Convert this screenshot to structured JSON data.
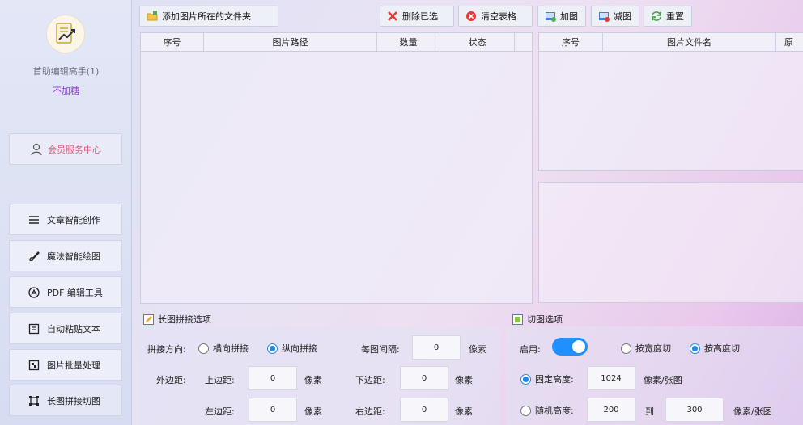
{
  "sidebar": {
    "user_name": "首助编辑高手(1)",
    "user_level": "不加糖",
    "member_label": "会员服务中心",
    "items": [
      {
        "label": "文章智能创作",
        "icon": "list-icon"
      },
      {
        "label": "魔法智能绘图",
        "icon": "brush-icon"
      },
      {
        "label": "PDF 编辑工具",
        "icon": "pdf-icon"
      },
      {
        "label": "自动粘贴文本",
        "icon": "paste-icon"
      },
      {
        "label": "图片批量处理",
        "icon": "image-icon"
      },
      {
        "label": "长图拼接切图",
        "icon": "crop-icon"
      }
    ]
  },
  "toolbar": {
    "add_folder": "添加图片所在的文件夹",
    "delete_selected": "删除已选",
    "clear_table": "清空表格",
    "add_image": "加图",
    "remove_image": "减图",
    "reset": "重置"
  },
  "left_table": {
    "columns": [
      "序号",
      "图片路径",
      "数量",
      "状态"
    ]
  },
  "right_table": {
    "columns": [
      "序号",
      "图片文件名",
      "原"
    ]
  },
  "stitch": {
    "title": "长图拼接选项",
    "direction_label": "拼接方向:",
    "horizontal": "横向拼接",
    "vertical": "纵向拼接",
    "direction_selected": "vertical",
    "gap_label": "每图间隔:",
    "gap_value": "0",
    "unit": "像素",
    "margin_label": "外边距:",
    "top_label": "上边距:",
    "top_value": "0",
    "bottom_label": "下边距:",
    "bottom_value": "0",
    "left_label": "左边距:",
    "left_value": "0",
    "right_label": "右边距:",
    "right_value": "0"
  },
  "cut": {
    "title": "切图选项",
    "enable_label": "启用:",
    "enabled": true,
    "by_width": "按宽度切",
    "by_height": "按高度切",
    "mode_selected": "height",
    "fixed_label": "固定高度:",
    "fixed_value": "1024",
    "unit_per": "像素/张图",
    "random_label": "随机高度:",
    "random_from": "200",
    "to_label": "到",
    "random_to": "300",
    "size_selected": "fixed"
  },
  "colors": {
    "accent": "#1e90ff",
    "member": "#d0627c",
    "level": "#8a3fd0"
  }
}
